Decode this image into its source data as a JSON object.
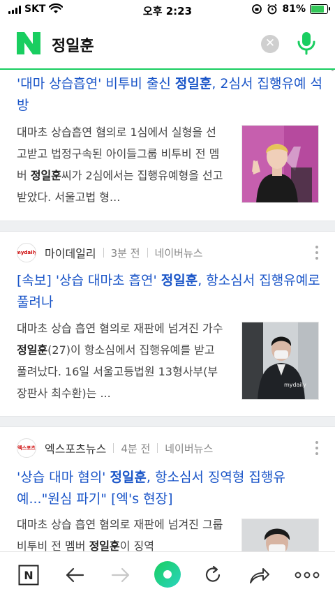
{
  "status_bar": {
    "carrier": "SKT",
    "time": "오후 2:23",
    "battery_percent": "81%",
    "battery_level": 0.81
  },
  "search": {
    "logo": "N",
    "query": "정일훈",
    "clear_icon": "close-icon",
    "mic_icon": "mic-icon"
  },
  "colors": {
    "naver_green": "#19ce60",
    "link_blue": "#1a55c8",
    "separator": "#eef0f2"
  },
  "articles": [
    {
      "title_pre": "'대마 상습흡연' 비투비 출신 ",
      "title_name": "정일훈",
      "title_post": ", 2심서 집행유예 석방",
      "snippet_pre": "대마초 상습흡연 혐의로 1심에서 실형을 선고받고 법정구속된 아이들그룹 비투비 전 멤버 ",
      "snippet_name": "정일훈",
      "snippet_post": "씨가 2심에서는 집행유예형을 선고받았다. 서울고법 형..."
    },
    {
      "publisher": "마이데일리",
      "publisher_logo_text": "mydaily",
      "time_ago": "3분 전",
      "source": "네이버뉴스",
      "title_pre": "[속보] '상습 대마초 흡연' ",
      "title_name": "정일훈",
      "title_post": ", 항소심서 집행유예로 풀려나",
      "snippet_pre": "대마초 상습 흡연 혐의로 재판에 넘겨진 가수 ",
      "snippet_name": "정일훈",
      "snippet_post": "(27)이 항소심에서 집행유예를 받고 풀려났다. 16일 서울고등법원 13형사부(부장판사 최수환)는 ...",
      "thumb_watermark": "mydaily"
    },
    {
      "publisher": "엑스포츠뉴스",
      "publisher_logo_text": "엑스포츠",
      "time_ago": "4분 전",
      "source": "네이버뉴스",
      "title_pre": "'상습 대마 혐의' ",
      "title_name": "정일훈",
      "title_post": ", 항소심서 징역형 집행유예...\"원심 파기\" [엑's 현장]",
      "snippet_pre": "대마초 상습 흡연 혐의로 재판에 넘겨진 그룹 비투비 전 멤버 ",
      "snippet_name": "정일훈",
      "snippet_post": "이 징역"
    }
  ],
  "toolbar": {
    "items": [
      "home-n-icon",
      "back-arrow-icon",
      "forward-arrow-icon",
      "green-dot-icon",
      "reload-icon",
      "share-icon",
      "more-icon"
    ],
    "home_label": "N"
  }
}
